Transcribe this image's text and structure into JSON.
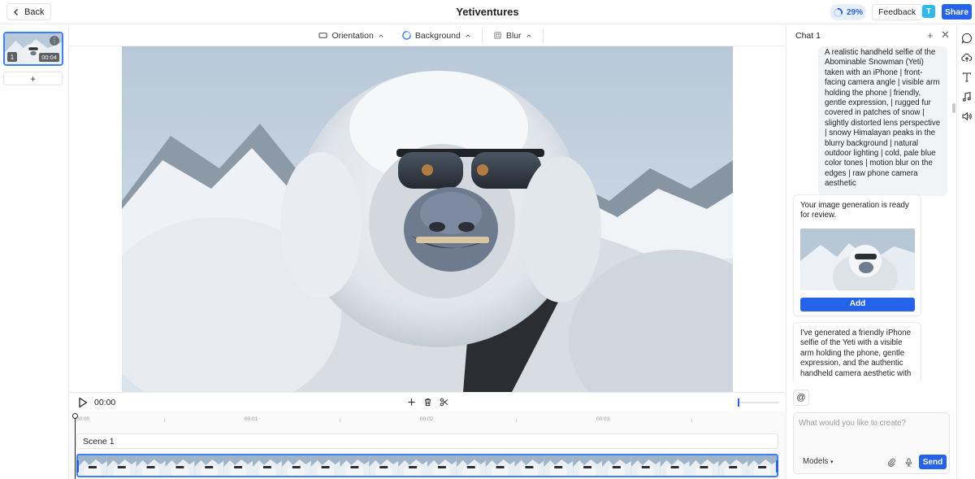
{
  "header": {
    "back_label": "Back",
    "title": "Yetiventures",
    "progress_label": "29%",
    "progress_value": 0.29,
    "feedback_label": "Feedback",
    "avatar_initial": "T",
    "share_label": "Share"
  },
  "scenes": {
    "items": [
      {
        "index": "1",
        "duration": "00:04"
      }
    ],
    "add_label": "+"
  },
  "toolbar": {
    "orientation_label": "Orientation",
    "background_label": "Background",
    "blur_label": "Blur"
  },
  "playback": {
    "time": "00:00",
    "zoom_level": 0.0
  },
  "timeline": {
    "ticks": [
      "00:00",
      "00:01",
      "00:02",
      "00:03"
    ],
    "scene_label": "Scene 1"
  },
  "chat": {
    "title": "Chat 1",
    "user_prompt": "A realistic handheld selfie of the Abominable Snowman (Yeti) taken with an iPhone | front-facing camera angle | visible arm holding the phone | friendly, gentle expression, | rugged fur covered in patches of snow | slightly distorted lens perspective | snowy Himalayan peaks in the blurry background | natural outdoor lighting | cold, pale blue color tones | motion blur on the edges | raw phone camera aesthetic",
    "ai_ready_message": "Your image generation is ready for review.",
    "add_label": "Add",
    "ai_followup_message": "I've generated a friendly iPhone selfie of the Yeti with a visible arm holding the phone, gentle expression, and the authentic handheld camera aesthetic with",
    "mention_label": "@",
    "input_placeholder": "What would you like to create?",
    "input_value": "",
    "models_label": "Models",
    "send_label": "Send"
  },
  "icons": {
    "back": "chevron-left-icon",
    "orientation": "rectangle-icon",
    "background": "color-circle-icon",
    "blur": "blur-icon",
    "play": "play-icon",
    "add": "plus-icon",
    "delete": "trash-icon",
    "cut": "scissors-icon",
    "chat": "chat-bubble-icon",
    "upload": "cloud-upload-icon",
    "text": "text-icon",
    "music": "music-note-icon",
    "audio": "speaker-icon"
  },
  "colors": {
    "accent": "#2563eb",
    "avatar": "#2fb8e8",
    "progress_bg": "#e8f0fe"
  }
}
